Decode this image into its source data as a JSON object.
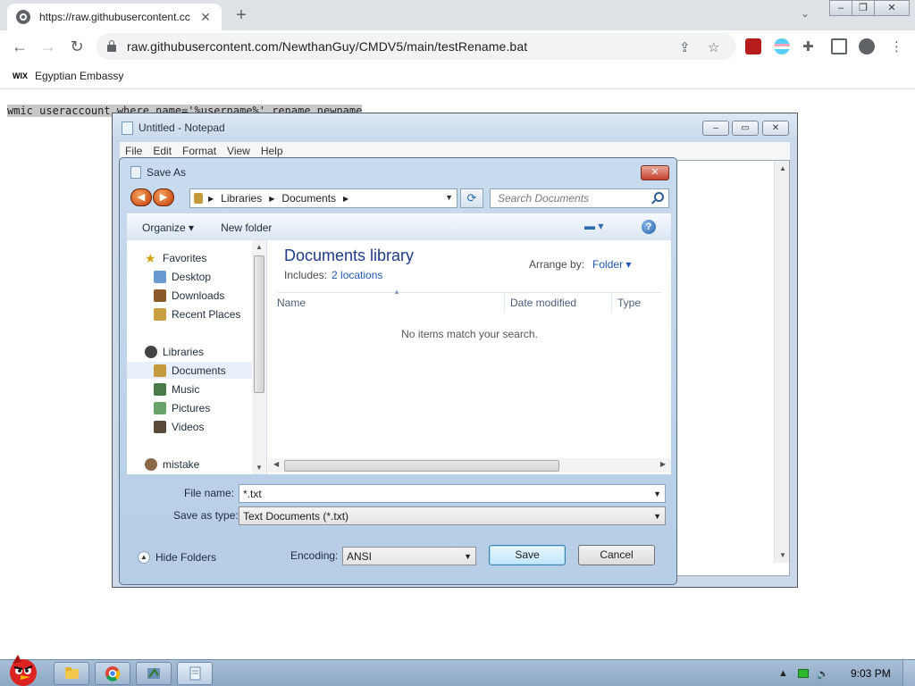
{
  "browser": {
    "tab_title": "https://raw.githubusercontent.cc",
    "url": "raw.githubusercontent.com/NewthanGuy/CMDV5/main/testRename.bat",
    "bookmark_label": "Egyptian Embassy",
    "bookmark_logo": "WIX"
  },
  "page": {
    "text": "wmic useraccount where name='%username%' rename newname"
  },
  "notepad": {
    "title": "Untitled - Notepad",
    "menu": [
      "File",
      "Edit",
      "Format",
      "View",
      "Help"
    ]
  },
  "save_as": {
    "title": "Save As",
    "breadcrumb": [
      "Libraries",
      "Documents"
    ],
    "search_placeholder": "Search Documents",
    "organize_label": "Organize ▾",
    "new_folder_label": "New folder",
    "nav": {
      "favorites": "Favorites",
      "desktop": "Desktop",
      "downloads": "Downloads",
      "recent": "Recent Places",
      "libraries": "Libraries",
      "documents": "Documents",
      "music": "Music",
      "pictures": "Pictures",
      "videos": "Videos",
      "mistake": "mistake"
    },
    "library_title": "Documents library",
    "includes_label": "Includes:",
    "includes_link": "2 locations",
    "arrange_label": "Arrange by:",
    "arrange_value": "Folder ▾",
    "columns": [
      "Name",
      "Date modified",
      "Type"
    ],
    "empty_message": "No items match your search.",
    "file_name_label": "File name:",
    "file_name_value": "*.txt",
    "save_type_label": "Save as type:",
    "save_type_value": "Text Documents (*.txt)",
    "hide_folders_label": "Hide Folders",
    "encoding_label": "Encoding:",
    "encoding_value": "ANSI",
    "save_label": "Save",
    "cancel_label": "Cancel"
  },
  "taskbar": {
    "time": "9:03 PM"
  }
}
